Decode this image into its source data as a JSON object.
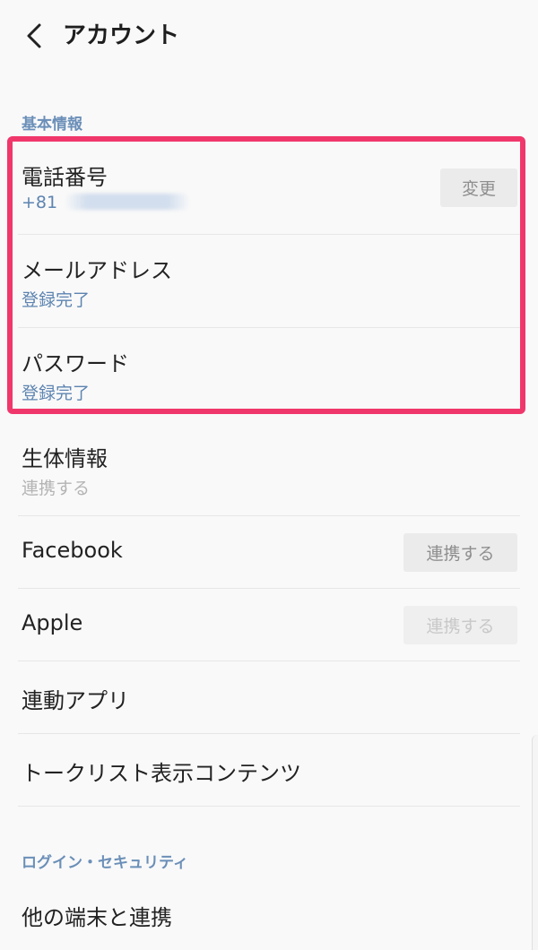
{
  "header": {
    "title": "アカウント",
    "back_icon": "chevron-left-icon"
  },
  "sections": {
    "basic_info": "基本情報",
    "login_security": "ログイン・セキュリティ"
  },
  "rows": {
    "phone": {
      "title": "電話番号",
      "value": "+81",
      "button": "変更"
    },
    "email": {
      "title": "メールアドレス",
      "status": "登録完了"
    },
    "password": {
      "title": "パスワード",
      "status": "登録完了"
    },
    "biometric": {
      "title": "生体情報",
      "status": "連携する"
    },
    "facebook": {
      "title": "Facebook",
      "button": "連携する"
    },
    "apple": {
      "title": "Apple",
      "button": "連携する"
    },
    "linked_apps": {
      "title": "連動アプリ"
    },
    "talk_list": {
      "title": "トークリスト表示コンテンツ"
    },
    "other_devices": {
      "title": "他の端末と連携"
    }
  },
  "colors": {
    "section_label": "#6b8fb8",
    "status_blue": "#5d84b1",
    "highlight": "#f0376b"
  }
}
